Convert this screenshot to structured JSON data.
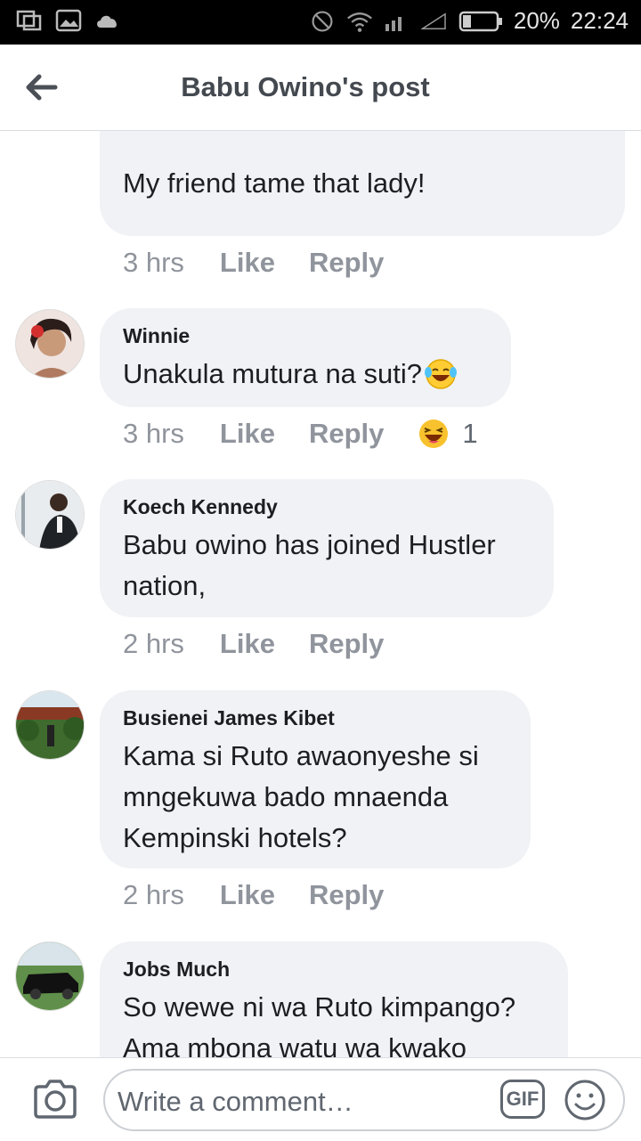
{
  "statusbar": {
    "battery": "20%",
    "time": "22:24"
  },
  "header": {
    "title": "Babu Owino's post"
  },
  "comments": [
    {
      "author": "",
      "text": "My friend tame that lady!",
      "time": "3 hrs",
      "like": "Like",
      "reply": "Reply"
    },
    {
      "author": "Winnie",
      "text": "Unakula mutura na suti?",
      "time": "3 hrs",
      "like": "Like",
      "reply": "Reply",
      "reaction_count": "1"
    },
    {
      "author": "Koech Kennedy",
      "text": "Babu owino has joined Hustler nation,",
      "time": "2 hrs",
      "like": "Like",
      "reply": "Reply"
    },
    {
      "author": "Busienei James Kibet",
      "text": "Kama si Ruto awaonyeshe si mngekuwa bado mnaenda Kempinski hotels?",
      "time": "2 hrs",
      "like": "Like",
      "reply": "Reply"
    },
    {
      "author": "Jobs Much",
      "text": "So wewe ni wa Ruto kimpango? Ama mbona watu wa kwako",
      "time": "",
      "like": "",
      "reply": ""
    }
  ],
  "composer": {
    "placeholder": "Write a comment…",
    "gif_label": "GIF"
  },
  "colors": {
    "bubble": "#f0f2f5",
    "meta": "#90949c",
    "statusbar": "#000000"
  }
}
